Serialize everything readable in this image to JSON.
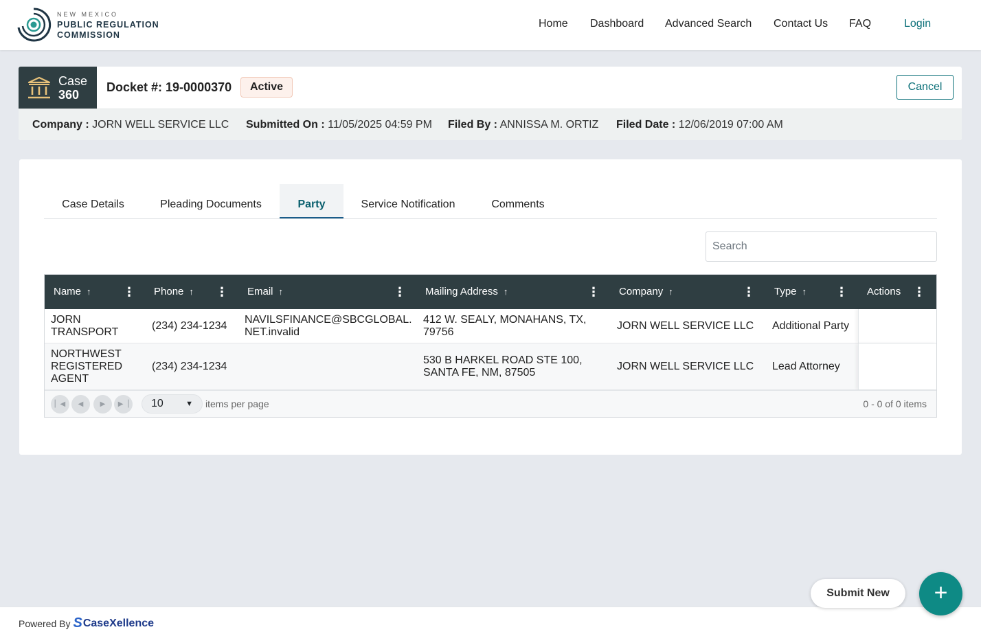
{
  "header": {
    "logo_small": "NEW MEXICO",
    "logo_line1": "PUBLIC REGULATION",
    "logo_line2": "COMMISSION",
    "nav": [
      "Home",
      "Dashboard",
      "Advanced Search",
      "Contact Us",
      "FAQ",
      "Login"
    ]
  },
  "case": {
    "badge_line1": "Case",
    "badge_line2": "360",
    "docket": "Docket #: 19-0000370",
    "status": "Active",
    "cancel_label": "Cancel",
    "company_label": "Company :",
    "company_value": "JORN WELL SERVICE LLC",
    "submitted_label": "Submitted On :",
    "submitted_value": "11/05/2025 04:59 PM",
    "filedby_label": "Filed By :",
    "filedby_value": "ANNISSA M. ORTIZ",
    "fileddate_label": "Filed Date :",
    "fileddate_value": "12/06/2019 07:00 AM"
  },
  "tabs": [
    "Case Details",
    "Pleading Documents",
    "Party",
    "Service Notification",
    "Comments"
  ],
  "active_tab": "Party",
  "search": {
    "placeholder": "Search"
  },
  "grid": {
    "columns": [
      "Name",
      "Phone",
      "Email",
      "Mailing Address",
      "Company",
      "Type",
      "Actions"
    ],
    "rows": [
      {
        "name_l1": "JORN",
        "name_l2": "TRANSPORT",
        "name_l3": "",
        "phone": "(234) 234-1234",
        "email_l1": "NAVILSFINANCE@SBCGLOBAL.",
        "email_l2": "NET.invalid",
        "address_l1": "412 W. SEALY, MONAHANS, TX,",
        "address_l2": "79756",
        "company": "JORN WELL SERVICE LLC",
        "type": "Additional Party"
      },
      {
        "name_l1": "NORTHWEST",
        "name_l2": "REGISTERED",
        "name_l3": "AGENT",
        "phone": "(234) 234-1234",
        "email_l1": "",
        "email_l2": "",
        "address_l1": "530 B HARKEL ROAD STE 100,",
        "address_l2": "SANTA FE, NM, 87505",
        "company": "JORN WELL SERVICE LLC",
        "type": "Lead Attorney"
      }
    ],
    "page_size": "10",
    "page_size_label": "items per page",
    "page_info": "0 - 0 of 0 items"
  },
  "footer": {
    "powered_by": "Powered By",
    "brand": "CaseXellence"
  },
  "fab": {
    "label": "Submit New",
    "icon": "+"
  },
  "colors": {
    "accent": "#0a6f78",
    "header_dark": "#2f3e42",
    "fab": "#0e8a85"
  }
}
